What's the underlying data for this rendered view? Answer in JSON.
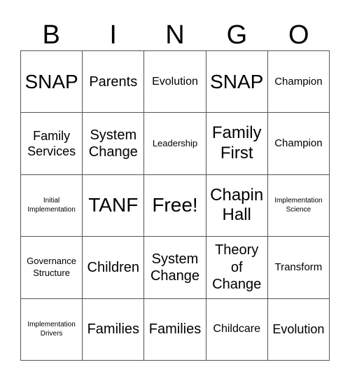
{
  "header": [
    "B",
    "I",
    "N",
    "G",
    "O"
  ],
  "cells": [
    {
      "text": "SNAP",
      "size": "s-xl"
    },
    {
      "text": "Parents",
      "size": "s-m"
    },
    {
      "text": "Evolution",
      "size": "s-s"
    },
    {
      "text": "SNAP",
      "size": "s-xl"
    },
    {
      "text": "Champion",
      "size": "s-xs"
    },
    {
      "text": "Family Services",
      "size": "s-sm"
    },
    {
      "text": "System Change",
      "size": "s-m"
    },
    {
      "text": "Leadership",
      "size": "s-xxs"
    },
    {
      "text": "Family First",
      "size": "s-l"
    },
    {
      "text": "Champion",
      "size": "s-xs"
    },
    {
      "text": "Initial Implementation",
      "size": "s-tiny"
    },
    {
      "text": "TANF",
      "size": "s-xl"
    },
    {
      "text": "Free!",
      "size": "s-xl"
    },
    {
      "text": "Chapin Hall",
      "size": "s-l"
    },
    {
      "text": "Implementation Science",
      "size": "s-tiny"
    },
    {
      "text": "Governance Structure",
      "size": "s-xxs"
    },
    {
      "text": "Children",
      "size": "s-m"
    },
    {
      "text": "System Change",
      "size": "s-m"
    },
    {
      "text": "Theory of Change",
      "size": "s-m"
    },
    {
      "text": "Transform",
      "size": "s-xs"
    },
    {
      "text": "Implementation Drivers",
      "size": "s-tiny"
    },
    {
      "text": "Families",
      "size": "s-m"
    },
    {
      "text": "Families",
      "size": "s-m"
    },
    {
      "text": "Childcare",
      "size": "s-s"
    },
    {
      "text": "Evolution",
      "size": "s-sm"
    }
  ]
}
